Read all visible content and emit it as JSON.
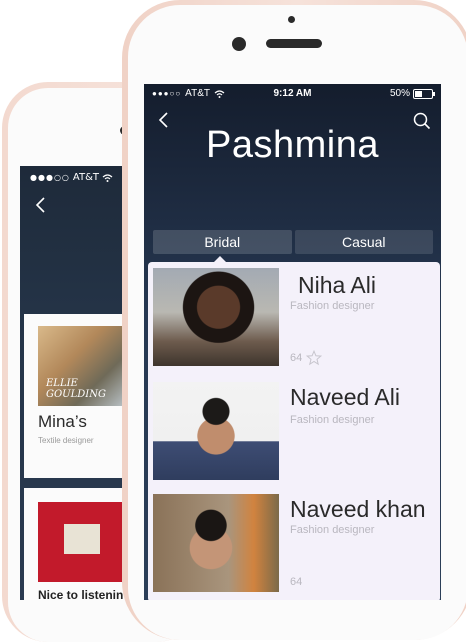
{
  "back_phone": {
    "status": {
      "carrier": "AT&T"
    },
    "cards": [
      {
        "title": "Mina’s",
        "subtitle": "Textile designer",
        "album_text": "ELLIE GOULDING"
      },
      {
        "title": "Nice to listenin"
      }
    ]
  },
  "front_phone": {
    "status": {
      "carrier": "AT&T",
      "time": "9:12 AM",
      "battery": "50%",
      "battery_level": 0.5
    },
    "title": "Pashmina",
    "tabs": [
      {
        "label": "Bridal",
        "active": true
      },
      {
        "label": "Casual",
        "active": false
      }
    ],
    "designers": [
      {
        "name": "Niha Ali",
        "role": "Fashion designer",
        "rating": "64"
      },
      {
        "name": "Naveed Ali",
        "role": "Fashion designer"
      },
      {
        "name": "Naveed khan",
        "role": "Fashion designer",
        "rating": "64"
      }
    ]
  }
}
